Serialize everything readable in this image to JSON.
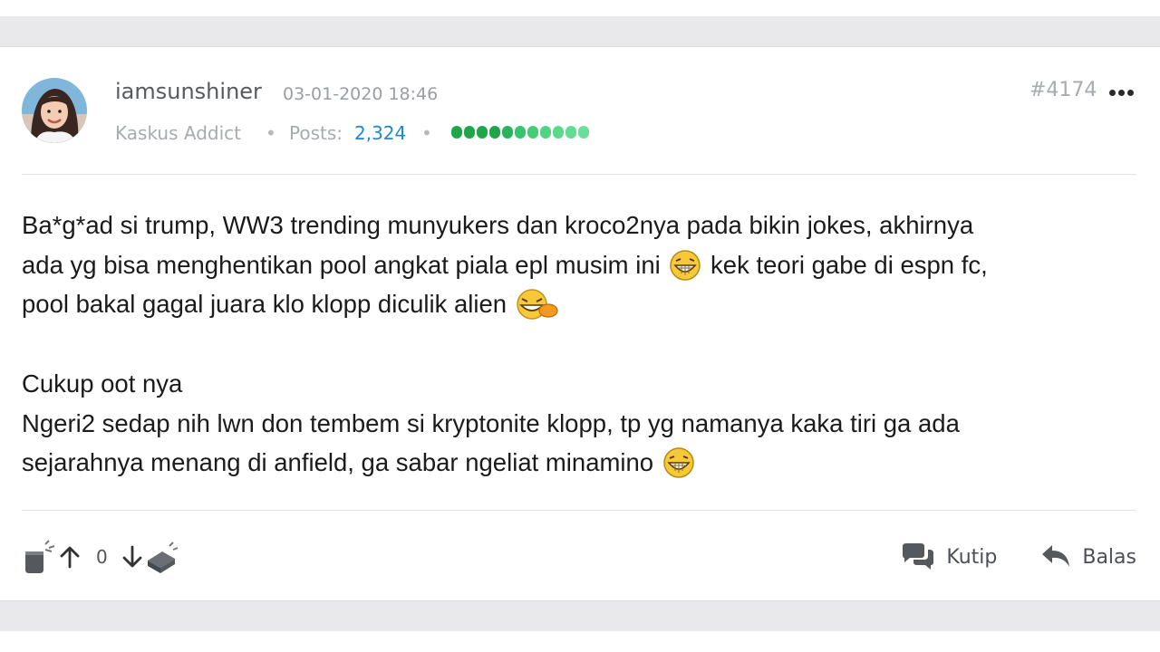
{
  "post": {
    "username": "iamsunshiner",
    "timestamp": "03-01-2020 18:46",
    "rank": "Kaskus Addict",
    "separator": "•",
    "posts_label": "Posts:",
    "posts_count": "2,324",
    "post_number": "#4174",
    "reputation": {
      "total_pips": 11,
      "colors": [
        "#1fa64a",
        "#1fa64a",
        "#1fa64a",
        "#1fa64a",
        "#29b45a",
        "#36c46c",
        "#44cc78",
        "#52d384",
        "#5ad98c",
        "#61dc92",
        "#6adf99"
      ]
    },
    "body": {
      "line1": "Ba*g*ad si trump, WW3 trending munyukers dan kroco2nya pada bikin jokes, akhirnya",
      "line2a": "ada yg bisa menghentikan pool angkat piala epl musim ini",
      "line2b": "kek teori gabe di espn fc,",
      "line3": "pool bakal gagal juara klo klopp diculik alien",
      "line4": "Cukup oot nya",
      "line5": "Ngeri2 sedap nih lwn don tembem si kryptonite klopp, tp yg namanya kaka tiri ga ada",
      "line6": "sejarahnya menang di anfield, ga sabar ngeliat minamino"
    },
    "footer": {
      "vote_count": "0",
      "quote_label": "Kutip",
      "reply_label": "Balas"
    }
  },
  "icons": {
    "more": "more-options-icon",
    "cendol": "cendol-icon",
    "upvote": "arrow-up-icon",
    "downvote": "arrow-down-icon",
    "bata": "bata-icon",
    "quote": "chat-bubbles-icon",
    "reply": "reply-arrow-icon",
    "grin": "grin-emoji-icon",
    "laugh": "laugh-emoji-icon"
  }
}
